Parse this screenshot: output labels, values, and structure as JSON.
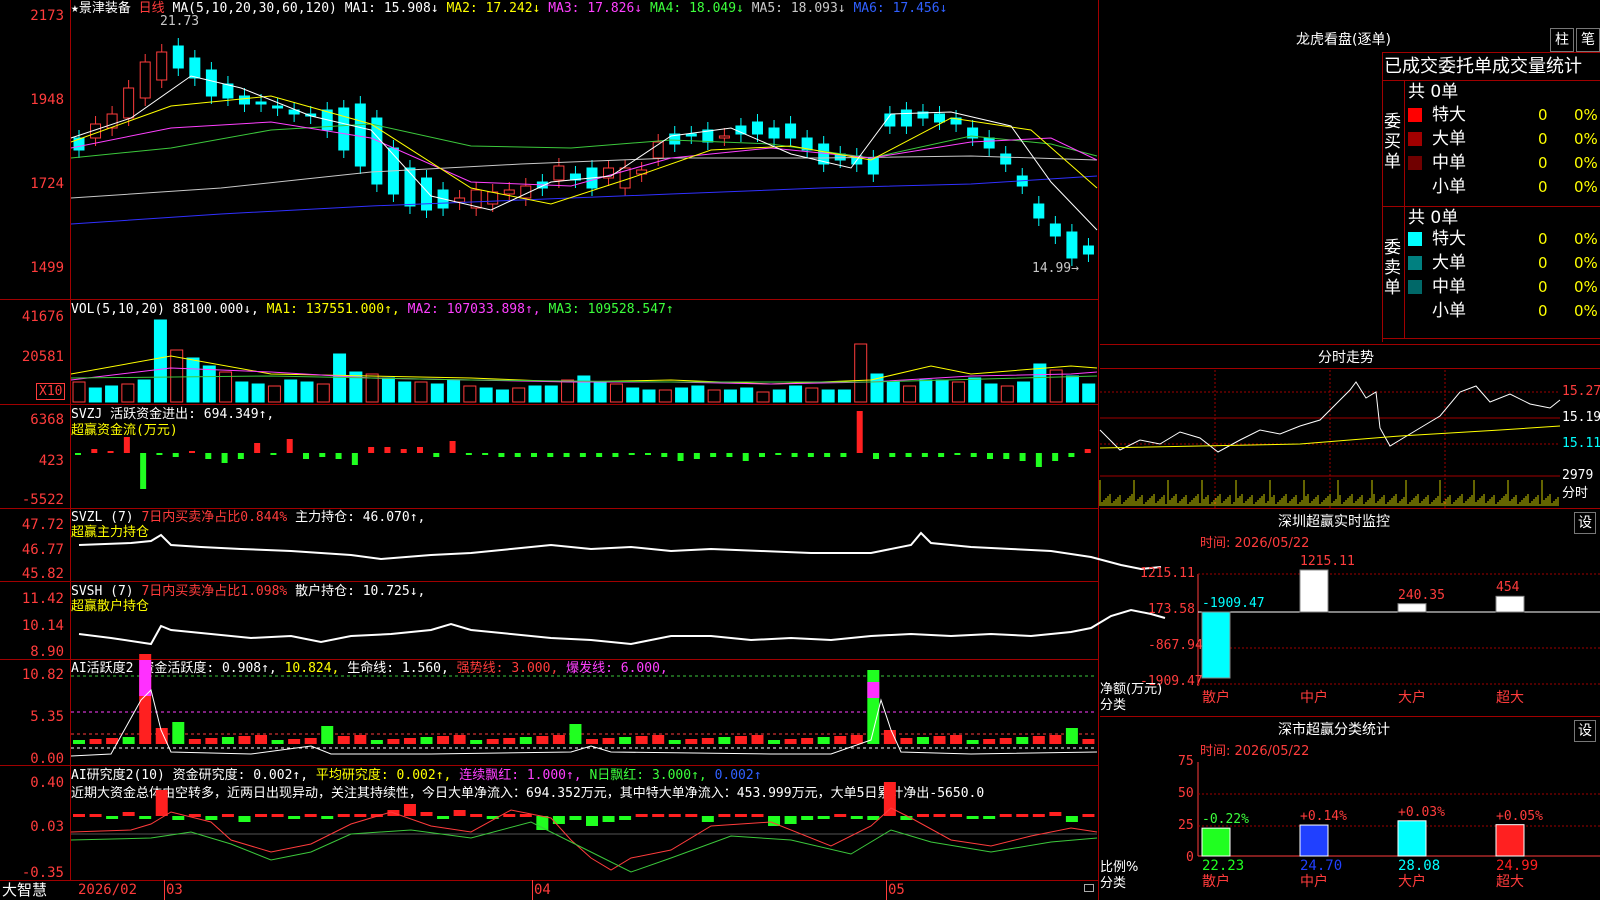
{
  "main": {
    "stock_name": "★景津装备",
    "period": "日线",
    "ma_prefix": "MA(5,10,20,30,60,120)",
    "ma_values": [
      {
        "label": "MA1: 15.908↓",
        "color": "#ffffff"
      },
      {
        "label": "MA2: 17.242↓",
        "color": "#ffff00"
      },
      {
        "label": "MA3: 17.826↓",
        "color": "#ff40ff"
      },
      {
        "label": "MA4: 18.049↓",
        "color": "#3cff3c"
      },
      {
        "label": "MA5: 18.093↓",
        "color": "#c8c8c8"
      },
      {
        "label": "MA6: 17.456↓",
        "color": "#3060ff"
      }
    ],
    "y_ticks": [
      "2173",
      "1948",
      "1724",
      "1499"
    ],
    "high_marker": "21.73",
    "low_marker": "14.99→"
  },
  "vol": {
    "label": "VOL(5,10,20)",
    "value": "88100.000↓,",
    "ma1": "MA1: 137551.000↑,",
    "ma2": "MA2: 107033.898↑,",
    "ma3": "MA3: 109528.547↑",
    "y_ticks": [
      "41676",
      "20581"
    ],
    "unit": "X10"
  },
  "svzj": {
    "label": "SVZJ  活跃资金进出: 694.349↑,",
    "sub": "超赢资金流(万元)",
    "y_ticks": [
      "6368",
      "423",
      "-5522"
    ]
  },
  "svzl": {
    "label": "SVZL (7)",
    "detail": "7日内买卖净占比0.844%",
    "holding": "主力持仓: 46.070↑,",
    "sub": "超赢主力持仓",
    "y_ticks": [
      "47.72",
      "46.77",
      "45.82"
    ]
  },
  "svsh": {
    "label": "SVSH (7)",
    "detail": "7日内买卖净占比1.098%",
    "holding": "散户持仓: 10.725↓,",
    "sub": "超赢散户持仓",
    "y_ticks": [
      "11.42",
      "10.14",
      "8.90"
    ]
  },
  "ai_active": {
    "label": "AI活跃度2",
    "funds": "资金活跃度: 0.908↑,",
    "val2": "10.824,",
    "life": "生命线: 1.560,",
    "strong": "强势线: 3.000,",
    "burst": "爆发线: 6.000,",
    "y_ticks": [
      "10.82",
      "5.35",
      "0.00"
    ]
  },
  "ai_research": {
    "label": "AI研究度2(10)",
    "funds": "资金研究度: 0.002↑,",
    "avg": "平均研究度: 0.002↑,",
    "cont": "连续飘红: 1.000↑,",
    "nday": "N日飘红: 3.000↑,",
    "tail": "0.002↑",
    "comment": "近期大资金总体由空转多，近两日出现异动，关注其持续性，今日大单净流入：694.352万元，其中特大单净流入：453.999万元，大单5日累计净出-5650.0",
    "y_ticks": [
      "0.40",
      "0.03",
      "-0.35"
    ]
  },
  "xaxis": {
    "brand": "大智慧",
    "labels": [
      "2026/02",
      "03",
      "04",
      "05"
    ]
  },
  "right": {
    "dragon_title": "龙虎看盘(逐单)",
    "btn_zhu": "柱",
    "btn_bi": "笔",
    "stats_title": "已成交委托单成交量统计",
    "buy": {
      "side": "委买单",
      "total": "共 0单",
      "rows": [
        {
          "name": "特大",
          "qty": "0",
          "pct": "0%",
          "color": "#ff0000"
        },
        {
          "name": "大单",
          "qty": "0",
          "pct": "0%",
          "color": "#a00000"
        },
        {
          "name": "中单",
          "qty": "0",
          "pct": "0%",
          "color": "#700000"
        },
        {
          "name": "小单",
          "qty": "0",
          "pct": "0%",
          "color": "#000000"
        }
      ]
    },
    "sell": {
      "side": "委卖单",
      "total": "共 0单",
      "rows": [
        {
          "name": "特大",
          "qty": "0",
          "pct": "0%",
          "color": "#00ffff"
        },
        {
          "name": "大单",
          "qty": "0",
          "pct": "0%",
          "color": "#008080"
        },
        {
          "name": "中单",
          "qty": "0",
          "pct": "0%",
          "color": "#006868"
        },
        {
          "name": "小单",
          "qty": "0",
          "pct": "0%",
          "color": "#000000"
        }
      ]
    },
    "intraday_title": "分时走势",
    "intraday_prices": [
      "15.27",
      "15.19",
      "15.11"
    ],
    "intraday_vol": "2979",
    "intraday_vol_unit": "分时",
    "sz_monitor_title": "深圳超赢实时监控",
    "sz_date": "时间: 2026/05/22",
    "set_btn": "设",
    "monitor_ticks": [
      "1215.11",
      "173.58",
      "-867.94",
      "-1909.47"
    ],
    "monitor_bars": [
      {
        "cat": "散户",
        "label": "-1909.47"
      },
      {
        "cat": "中户",
        "label": "1215.11"
      },
      {
        "cat": "大户",
        "label": "240.35"
      },
      {
        "cat": "超大",
        "label": "454"
      }
    ],
    "monitor_axis_name": "净额(万元)",
    "monitor_axis_name2": "分类",
    "stats2_title": "深市超赢分类统计",
    "stats2_date": "时间: 2026/05/22",
    "stats2_ticks": [
      "75",
      "50",
      "25",
      "0"
    ],
    "stats2_bars": [
      {
        "cat": "散户",
        "value": "22.23",
        "delta": "-0.22%"
      },
      {
        "cat": "中户",
        "value": "24.70",
        "delta": "+0.14%"
      },
      {
        "cat": "大户",
        "value": "28.08",
        "delta": "+0.03%"
      },
      {
        "cat": "超大",
        "value": "24.99",
        "delta": "+0.05%"
      }
    ],
    "stats2_axis_name": "比例%",
    "stats2_axis_name2": "分类"
  },
  "chart_data": [
    {
      "type": "line",
      "title": "景津装备 日线",
      "series": [
        {
          "name": "MA1",
          "values": [
            15.908
          ]
        },
        {
          "name": "MA2",
          "values": [
            17.242
          ]
        },
        {
          "name": "MA3",
          "values": [
            17.826
          ]
        },
        {
          "name": "MA4",
          "values": [
            18.049
          ]
        },
        {
          "name": "MA5",
          "values": [
            18.093
          ]
        },
        {
          "name": "MA6",
          "values": [
            17.456
          ]
        }
      ],
      "ylim": [
        14.99,
        21.73
      ]
    },
    {
      "type": "bar",
      "title": "深圳超赢实时监控",
      "categories": [
        "散户",
        "中户",
        "大户",
        "超大"
      ],
      "values": [
        -1909.47,
        1215.11,
        240.35,
        454
      ],
      "ylabel": "净额(万元)"
    },
    {
      "type": "bar",
      "title": "深市超赢分类统计",
      "categories": [
        "散户",
        "中户",
        "大户",
        "超大"
      ],
      "values": [
        22.23,
        24.7,
        28.08,
        24.99
      ],
      "ylabel": "比例%",
      "ylim": [
        0,
        75
      ]
    }
  ]
}
